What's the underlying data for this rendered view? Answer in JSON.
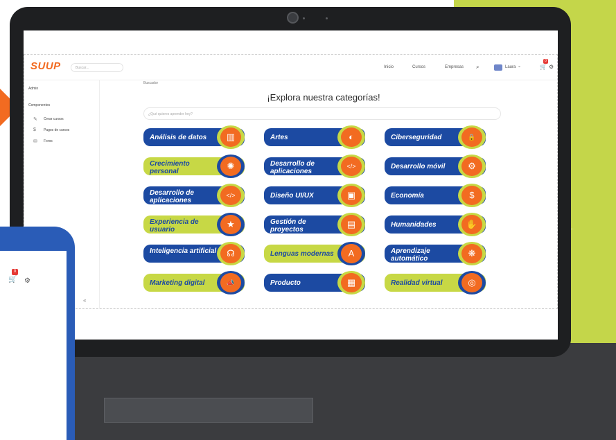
{
  "app": {
    "logo": "SUUP",
    "search_placeholder": "Buscar..."
  },
  "nav": {
    "items": [
      "Inicio",
      "Cursos",
      "Empresas"
    ],
    "user": "Laura",
    "cart_count": "0"
  },
  "sidebar": {
    "role": "Admin",
    "section": "Componentes",
    "items": [
      "Crear cursos",
      "Pagos de cursos",
      "Foros"
    ]
  },
  "main": {
    "breadcrumb": "Buscador",
    "title": "¡Explora nuestra categorías!",
    "search_placeholder": "¿Qué quieres aprender hoy?"
  },
  "categories": [
    {
      "label": "Análisis de datos",
      "icon": "chart-icon",
      "style": "blue"
    },
    {
      "label": "Artes",
      "icon": "palette-icon",
      "style": "blue"
    },
    {
      "label": "Ciberseguridad",
      "icon": "lock-icon",
      "style": "blue"
    },
    {
      "label": "Crecimiento personal",
      "icon": "bulb-icon",
      "style": "green"
    },
    {
      "label": "Desarrollo de aplicaciones",
      "icon": "phone-code-icon",
      "style": "blue"
    },
    {
      "label": "Desarrollo móvil",
      "icon": "mobile-gear-icon",
      "style": "blue"
    },
    {
      "label": "Desarrollo de aplicaciones",
      "icon": "phone-code-icon",
      "style": "blue"
    },
    {
      "label": "Diseño UI/UX",
      "icon": "uiux-icon",
      "style": "blue"
    },
    {
      "label": "Economía",
      "icon": "coin-icon",
      "style": "blue"
    },
    {
      "label": "Experiencia de usuario",
      "icon": "user-star-icon",
      "style": "green"
    },
    {
      "label": "Gestión de proyectos",
      "icon": "document-icon",
      "style": "blue"
    },
    {
      "label": "Humanidades",
      "icon": "handshake-icon",
      "style": "blue"
    },
    {
      "label": "Inteligencia artificial",
      "icon": "brain-head-icon",
      "style": "blue"
    },
    {
      "label": "Lenguas modernas",
      "icon": "translate-icon",
      "style": "green"
    },
    {
      "label": "Aprendizaje automático",
      "icon": "brain-icon",
      "style": "blue"
    },
    {
      "label": "Marketing digital",
      "icon": "megaphone-icon",
      "style": "green"
    },
    {
      "label": "Producto",
      "icon": "box-icon",
      "style": "blue"
    },
    {
      "label": "Realidad virtual",
      "icon": "vr-icon",
      "style": "green"
    }
  ],
  "colors": {
    "blue": "#1c4aa2",
    "green": "#c7d845",
    "orange": "#f26b21",
    "lime_deco": "#c4d64a"
  }
}
